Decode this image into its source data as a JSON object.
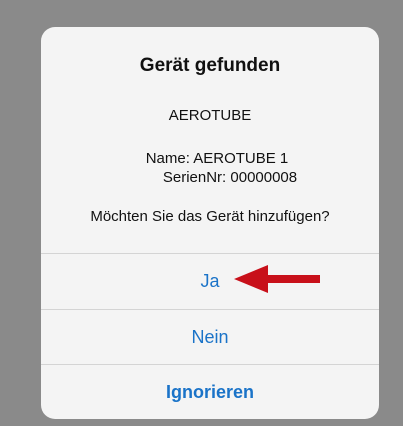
{
  "dialog": {
    "title": "Gerät gefunden",
    "device_type": "AEROTUBE",
    "name_line": "Name: AEROTUBE 1",
    "serial_line": "SerienNr: 00000008",
    "question": "Möchten Sie das Gerät hinzufügen?"
  },
  "actions": {
    "yes_label": "Ja",
    "no_label": "Nein",
    "ignore_label": "Ignorieren"
  },
  "annotation": {
    "arrow_icon": "red-arrow-left-icon",
    "arrow_color": "#c8101a"
  },
  "colors": {
    "backdrop": "#8a8a8a",
    "dialog_bg": "#f4f4f4",
    "action_text": "#1a73c8",
    "separator": "#d4d4d4"
  }
}
